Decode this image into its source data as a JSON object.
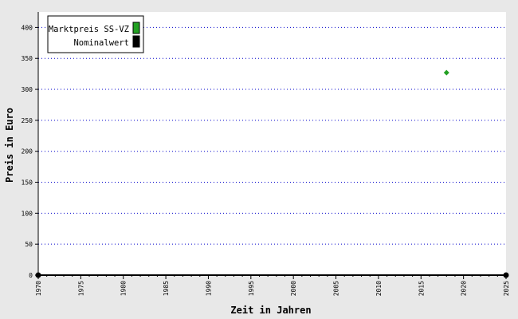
{
  "chart_data": {
    "type": "scatter",
    "xlabel": "Zeit in Jahren",
    "ylabel": "Preis in Euro",
    "xlim": [
      1970,
      2025
    ],
    "ylim": [
      0,
      425
    ],
    "x_ticks": [
      1970,
      1975,
      1980,
      1985,
      1990,
      1995,
      2000,
      2005,
      2010,
      2015,
      2020,
      2025
    ],
    "y_ticks": [
      0,
      50,
      100,
      150,
      200,
      250,
      300,
      350,
      400
    ],
    "grid": "horizontal dotted",
    "legend_position": "top-left",
    "series": [
      {
        "name": "Marktpreis SS-VZ",
        "color": "#22a022",
        "marker": "diamond",
        "points": [
          {
            "x": 2018,
            "y": 327
          }
        ]
      },
      {
        "name": "Nominalwert",
        "color": "#000000",
        "marker": "circle",
        "points": [
          {
            "x": 1970,
            "y": 0
          },
          {
            "x": 2025,
            "y": 0
          }
        ]
      }
    ],
    "colors": {
      "background": "#e8e8e8",
      "plot_background": "#ffffff",
      "grid": "#0000cc",
      "axis": "#000000"
    }
  }
}
